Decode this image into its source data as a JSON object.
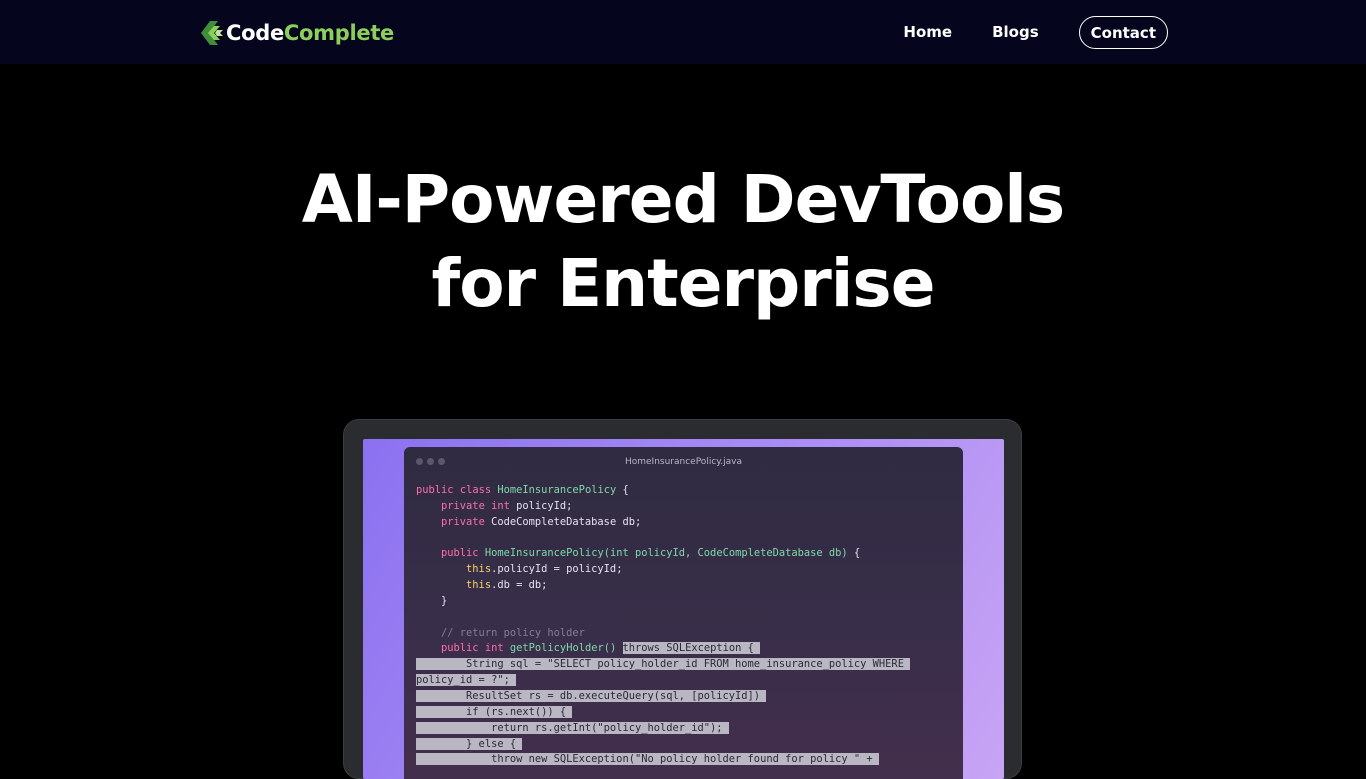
{
  "brand": {
    "name_part1": "Code",
    "name_part2": "Complete",
    "logo_icon": "codecomplete-logo-icon",
    "accent_color": "#8ccf5a"
  },
  "nav": {
    "home": "Home",
    "blogs": "Blogs",
    "contact": "Contact"
  },
  "hero": {
    "title_line1": "AI-Powered DevTools",
    "title_line2": "for Enterprise"
  },
  "editor": {
    "filename": "HomeInsurancePolicy.java",
    "lines": [
      "public class HomeInsurancePolicy {",
      "    private int policyId;",
      "    private CodeCompleteDatabase db;",
      "",
      "    public HomeInsurancePolicy(int policyId, CodeCompleteDatabase db) {",
      "        this.policyId = policyId;",
      "        this.db = db;",
      "    }",
      "",
      "    // return policy holder",
      "    public int getPolicyHolder() throws SQLException {",
      "        String sql = \"SELECT policy_holder_id FROM home_insurance_policy WHERE",
      "policy_id = ?\";",
      "        ResultSet rs = db.executeQuery(sql, [policyId])",
      "        if (rs.next()) {",
      "            return rs.getInt(\"policy_holder_id\");",
      "        } else {",
      "            throw new SQLException(\"No policy holder found for policy \" +"
    ]
  }
}
